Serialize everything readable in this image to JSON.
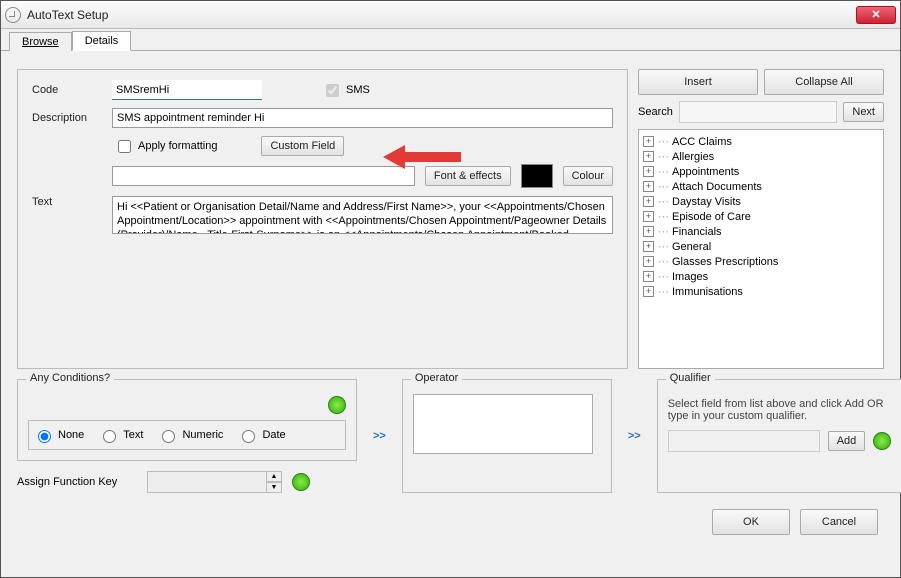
{
  "window": {
    "title": "AutoText Setup"
  },
  "tabs": {
    "browse": "Browse",
    "details": "Details"
  },
  "labels": {
    "code": "Code",
    "description": "Description",
    "text": "Text",
    "apply_formatting": "Apply formatting",
    "sms": "SMS",
    "any_conditions": "Any Conditions?",
    "operator": "Operator",
    "qualifier": "Qualifier",
    "assign_fn": "Assign Function Key",
    "search": "Search"
  },
  "buttons": {
    "custom_field": "Custom Field",
    "font_effects": "Font & effects",
    "colour": "Colour",
    "insert": "Insert",
    "collapse_all": "Collapse All",
    "next": "Next",
    "add": "Add",
    "ok": "OK",
    "cancel": "Cancel"
  },
  "fields": {
    "code": "SMSremHi",
    "description": "SMS appointment reminder Hi",
    "format_sample": "",
    "text": "Hi <<Patient or Organisation Detail/Name and Address/First Name>>, your <<Appointments/Chosen Appointment/Location>> appointment with <<Appointments/Chosen Appointment/Pageowner Details (Provider)/Name - Title-First-Surname>> is on <<Appointments/Chosen Appointment/Booked From(Day & Date)>> at <<Appointments/Chosen Appointment/Booked On (Time Only)>>. Txt Y to confim, N to cancel or call <<Appointments/Chosen Appointment/Hospital-Facility Details/Phone - Bus>> to rebook",
    "search": "",
    "qualifier": ""
  },
  "conditions": {
    "none": "None",
    "text": "Text",
    "numeric": "Numeric",
    "date": "Date"
  },
  "qualifier_hint": "Select field from list above and click Add OR type in your custom qualifier.",
  "tree": [
    "ACC Claims",
    "Allergies",
    "Appointments",
    "Attach Documents",
    "Daystay Visits",
    "Episode of Care",
    "Financials",
    "General",
    "Glasses Prescriptions",
    "Images",
    "Immunisations"
  ],
  "colors": {
    "swatch": "#000000",
    "arrow": "#e53935",
    "link": "#2a6fb5"
  }
}
